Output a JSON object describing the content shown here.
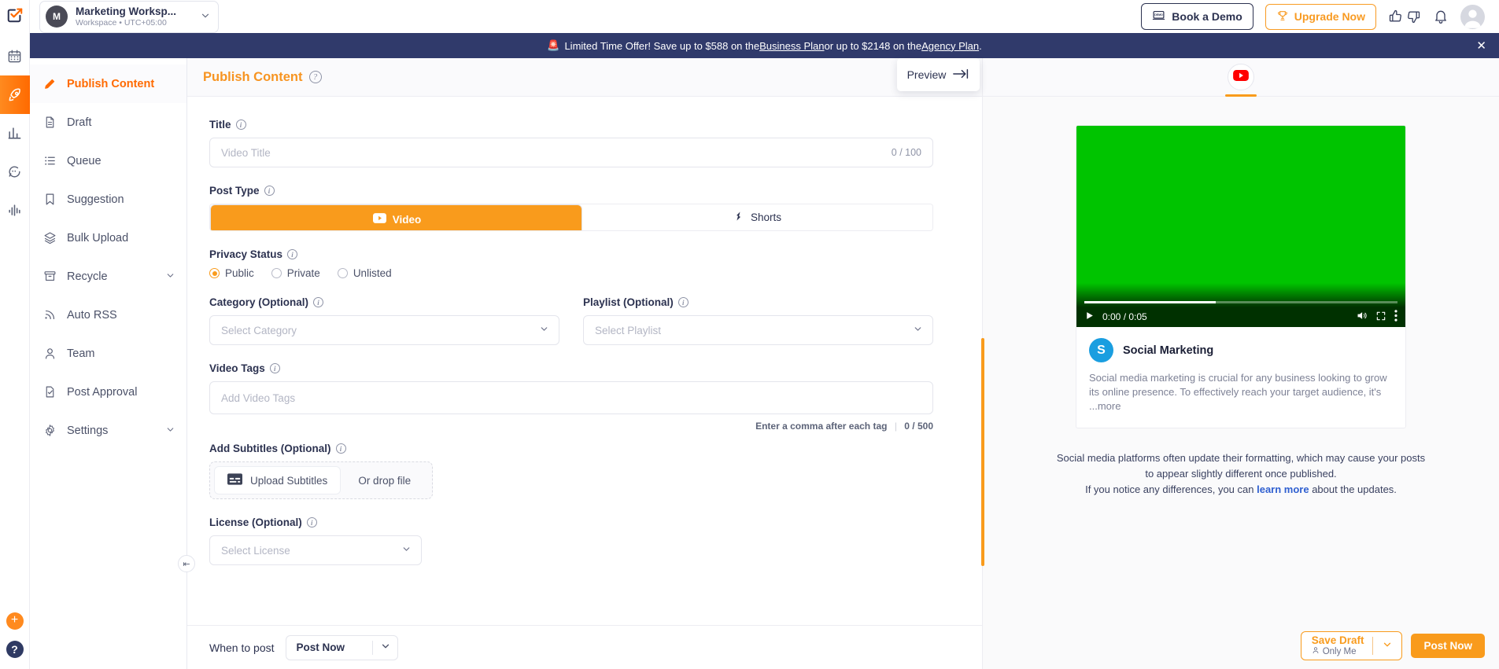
{
  "rail": {
    "logo_icon": "app-logo-icon",
    "items": [
      {
        "name": "calendar-icon"
      },
      {
        "name": "rocket-icon",
        "active": true
      },
      {
        "name": "analytics-icon"
      },
      {
        "name": "inbox-icon"
      },
      {
        "name": "reports-icon"
      }
    ],
    "add_label": "+",
    "help_label": "?"
  },
  "topbar": {
    "workspace": {
      "initial": "M",
      "name": "Marketing Worksp...",
      "subtitle": "Workspace • UTC+05:00"
    },
    "book_demo_label": "Book a Demo",
    "upgrade_label": "Upgrade Now"
  },
  "promo": {
    "emoji": "🚨",
    "text_before": "Limited Time Offer! Save up to $588 on the ",
    "link1": "Business Plan",
    "text_middle": " or up to $2148 on the ",
    "link2": "Agency Plan",
    "text_after": ".",
    "close_label": "✕"
  },
  "sidebar": {
    "items": [
      {
        "label": "Publish Content",
        "icon": "pencil-icon",
        "active": true,
        "chevron": false
      },
      {
        "label": "Draft",
        "icon": "document-icon",
        "active": false,
        "chevron": false
      },
      {
        "label": "Queue",
        "icon": "list-icon",
        "active": false,
        "chevron": false
      },
      {
        "label": "Suggestion",
        "icon": "bookmark-icon",
        "active": false,
        "chevron": false
      },
      {
        "label": "Bulk Upload",
        "icon": "layers-icon",
        "active": false,
        "chevron": false
      },
      {
        "label": "Recycle",
        "icon": "archive-icon",
        "active": false,
        "chevron": true
      },
      {
        "label": "Auto RSS",
        "icon": "rss-icon",
        "active": false,
        "chevron": false
      },
      {
        "label": "Team",
        "icon": "user-icon",
        "active": false,
        "chevron": false
      },
      {
        "label": "Post Approval",
        "icon": "approval-icon",
        "active": false,
        "chevron": false
      },
      {
        "label": "Settings",
        "icon": "gear-icon",
        "active": false,
        "chevron": true
      }
    ],
    "collapse_label": "⇤"
  },
  "main": {
    "header_title": "Publish Content",
    "title_field": {
      "label": "Title",
      "placeholder": "Video Title",
      "counter": "0 / 100"
    },
    "post_type": {
      "label": "Post Type",
      "options": [
        {
          "label": "Video",
          "icon": "youtube-play-icon",
          "selected": true
        },
        {
          "label": "Shorts",
          "icon": "shorts-icon",
          "selected": false
        }
      ]
    },
    "privacy": {
      "label": "Privacy Status",
      "options": [
        {
          "label": "Public",
          "selected": true
        },
        {
          "label": "Private",
          "selected": false
        },
        {
          "label": "Unlisted",
          "selected": false
        }
      ]
    },
    "category": {
      "label": "Category (Optional)",
      "placeholder": "Select Category"
    },
    "playlist": {
      "label": "Playlist (Optional)",
      "placeholder": "Select Playlist"
    },
    "video_tags": {
      "label": "Video Tags",
      "placeholder": "Add Video Tags",
      "hint": "Enter a comma after each tag",
      "counter": "0 / 500"
    },
    "subtitles": {
      "label": "Add Subtitles (Optional)",
      "upload_label": "Upload Subtitles",
      "drop_label": "Or drop file"
    },
    "license": {
      "label": "License (Optional)",
      "placeholder": "Select License"
    },
    "footer": {
      "when_label": "When to post",
      "when_value": "Post Now"
    }
  },
  "preview": {
    "tooltip_label": "Preview",
    "tooltip_icon": "arrow-to-right-icon",
    "tab_icon": "youtube-icon",
    "player": {
      "time": "0:00 / 0:05",
      "play_icon": "play-icon",
      "mute_icon": "volume-icon",
      "fullscreen_icon": "fullscreen-icon",
      "more_icon": "kebab-menu-icon"
    },
    "card": {
      "channel_initial": "S",
      "channel_name": "Social Marketing",
      "description": "Social media marketing is crucial for any business looking to grow its online presence. To effectively reach your target audience, it's",
      "more_label": "...more"
    },
    "note_line1": "Social media platforms often update their formatting, which may cause your posts",
    "note_line2": "to appear slightly different once published.",
    "note_line3_before": "If you notice any differences, you can ",
    "note_link": "learn more",
    "note_line3_after": " about the updates."
  },
  "actions": {
    "save_draft_label": "Save Draft",
    "save_draft_sub": "Only Me",
    "post_now_label": "Post Now"
  },
  "colors": {
    "accent_orange": "#f99b1c",
    "brand_orange": "#ff6a00",
    "banner_navy": "#303a6b",
    "youtube_red": "#ff0000",
    "video_green": "#00c400"
  }
}
